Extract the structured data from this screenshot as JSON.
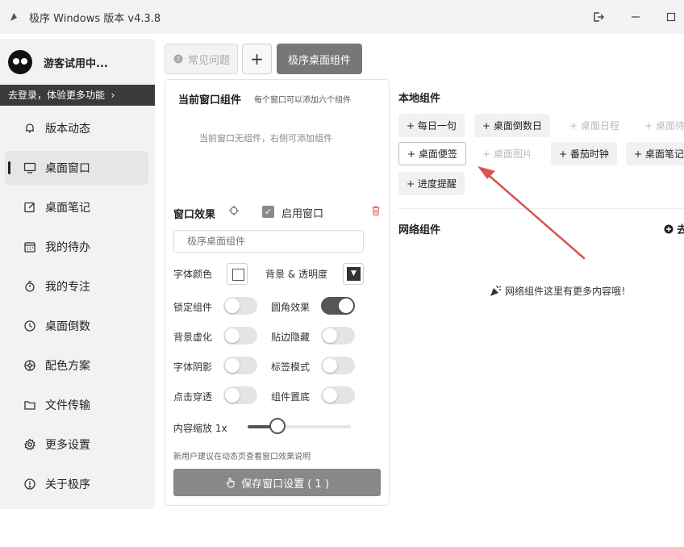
{
  "window": {
    "title": "极序 Windows 版本 v4.3.8"
  },
  "sidebar": {
    "user_name": "游客试用中...",
    "login_prompt": "去登录，体验更多功能",
    "items": [
      {
        "label": "版本动态",
        "icon": "bell-icon"
      },
      {
        "label": "桌面窗口",
        "icon": "monitor-icon",
        "active": true
      },
      {
        "label": "桌面笔记",
        "icon": "edit-icon"
      },
      {
        "label": "我的待办",
        "icon": "calendar-icon"
      },
      {
        "label": "我的专注",
        "icon": "stopwatch-icon"
      },
      {
        "label": "桌面倒数",
        "icon": "clock-icon"
      },
      {
        "label": "配色方案",
        "icon": "palette-icon"
      },
      {
        "label": "文件传输",
        "icon": "folder-icon"
      },
      {
        "label": "更多设置",
        "icon": "gear-icon"
      },
      {
        "label": "关于极序",
        "icon": "info-icon"
      }
    ]
  },
  "toolbar": {
    "faq_label": "常见问题",
    "add_label": "+",
    "widget_label": "极序桌面组件"
  },
  "current": {
    "title": "当前窗口组件",
    "subtitle": "每个窗口可以添加六个组件",
    "empty": "当前窗口无组件，右侧可添加组件"
  },
  "effects": {
    "title": "窗口效果",
    "enable_label": "启用窗口",
    "enabled": true,
    "name_placeholder": "极序桌面组件",
    "font_color_label": "字体颜色",
    "bg_label": "背景 & 透明度",
    "toggles": [
      {
        "label": "锁定组件",
        "on": false
      },
      {
        "label": "圆角效果",
        "on": true
      },
      {
        "label": "背景虚化",
        "on": false
      },
      {
        "label": "贴边隐藏",
        "on": false
      },
      {
        "label": "字体阴影",
        "on": false
      },
      {
        "label": "标签模式",
        "on": false
      },
      {
        "label": "点击穿透",
        "on": false
      },
      {
        "label": "组件置底",
        "on": false
      }
    ],
    "zoom_label": "内容缩放 1x",
    "zoom_fraction": 0.29,
    "hint": "新用户建议在动态页查看窗口效果说明",
    "save_label": "保存窗口设置 ( 1 )"
  },
  "local": {
    "title": "本地组件",
    "widgets": [
      {
        "label": "+ 每日一句",
        "state": "normal"
      },
      {
        "label": "+ 桌面倒数日",
        "state": "normal"
      },
      {
        "label": "+ 桌面日程",
        "state": "disabled"
      },
      {
        "label": "+ 桌面待",
        "state": "disabled"
      },
      {
        "label": "+ 桌面便签",
        "state": "selected"
      },
      {
        "label": "+ 桌面图片",
        "state": "disabled"
      },
      {
        "label": "+ 番茄时钟",
        "state": "normal"
      },
      {
        "label": "+ 桌面笔记",
        "state": "normal"
      },
      {
        "label": "+ 进度提醒",
        "state": "normal"
      }
    ]
  },
  "network": {
    "title": "网络组件",
    "link_label": "去",
    "empty": "网络组件这里有更多内容哦！"
  },
  "colors": {
    "accent": "#555555",
    "annotation_arrow": "#d9534f"
  }
}
